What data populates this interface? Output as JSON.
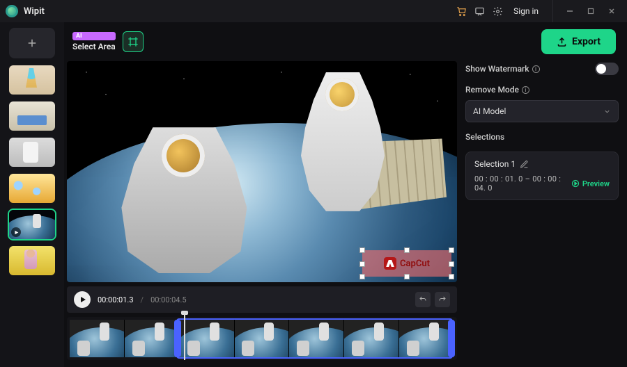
{
  "titlebar": {
    "app_name": "Wipit",
    "signin": "Sign in"
  },
  "toolbar": {
    "ai_badge": "AI",
    "select_area_label": "Select Area",
    "export_label": "Export"
  },
  "watermark": {
    "brand": "CapCut"
  },
  "playback": {
    "current": "00:00:01.3",
    "total": "00:00:04.5"
  },
  "panel": {
    "show_watermark_label": "Show Watermark",
    "remove_mode_label": "Remove Mode",
    "remove_mode_value": "AI Model",
    "selections_title": "Selections",
    "selection1_name": "Selection 1",
    "selection1_range": "00 : 00 : 01. 0  –  00 : 00 : 04. 0",
    "preview_label": "Preview"
  },
  "timeline": {
    "frame_count": 7,
    "selection_start_pct": 28,
    "selection_end_pct": 99,
    "playhead_pct": 30
  }
}
